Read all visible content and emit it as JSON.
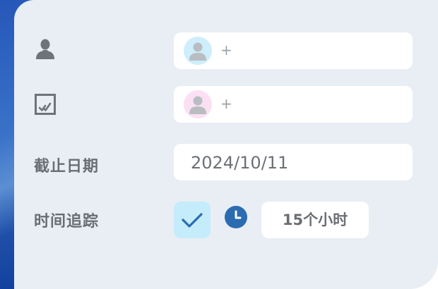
{
  "rows": {
    "assignee": {
      "icon": "person-icon",
      "avatar_icon": "avatar-placeholder-icon",
      "add_label": "+"
    },
    "reviewer": {
      "icon": "task-check-icon",
      "avatar_icon": "avatar-placeholder-icon",
      "add_label": "+"
    },
    "due_date": {
      "label": "截止日期",
      "value": "2024/10/11"
    },
    "time_tracking": {
      "label": "时间追踪",
      "check_icon": "checkmark-icon",
      "clock_icon": "clock-icon",
      "hours": "15个小时"
    }
  },
  "colors": {
    "accent": "#2b6cb0",
    "panel_bg": "#e9eef4",
    "label": "#6a6e74",
    "check_bg": "#c4ecfb",
    "avatar_blue": "#cdeefa",
    "avatar_pink": "#fbe0f4"
  }
}
